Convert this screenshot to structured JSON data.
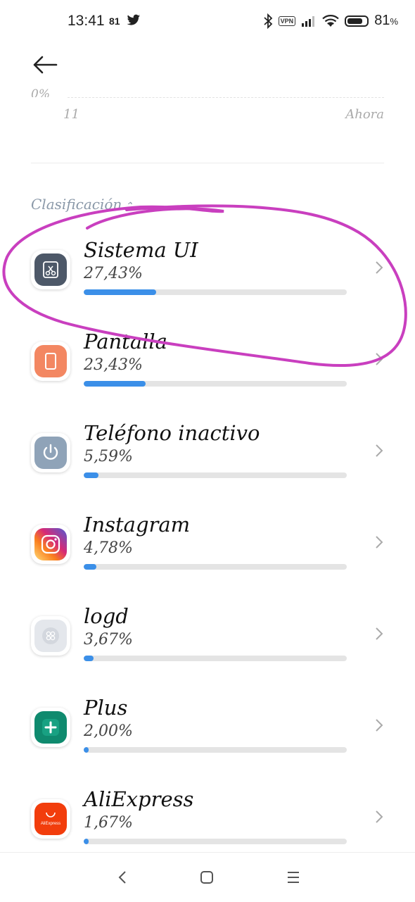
{
  "status_bar": {
    "time": "13:41",
    "notification_count": "81",
    "vpn_label": "VPN",
    "battery_value": "81",
    "battery_unit": "%",
    "battery_level": 0.81
  },
  "chart": {
    "y_min_label": "0%",
    "x_start_label": "11",
    "x_end_label": "Ahora"
  },
  "section": {
    "title": "Clasificación"
  },
  "items": [
    {
      "name": "Sistema UI",
      "percent": "27,43%",
      "fraction": 0.2743,
      "icon": "system-ui-icon",
      "color": "#4d5868"
    },
    {
      "name": "Pantalla",
      "percent": "23,43%",
      "fraction": 0.2343,
      "icon": "screen-icon",
      "color": "#f38762"
    },
    {
      "name": "Teléfono inactivo",
      "percent": "5,59%",
      "fraction": 0.0559,
      "icon": "power-icon",
      "color": "#8fa3b8"
    },
    {
      "name": "Instagram",
      "percent": "4,78%",
      "fraction": 0.0478,
      "icon": "instagram-icon",
      "color": "#d62976"
    },
    {
      "name": "logd",
      "percent": "3,67%",
      "fraction": 0.0367,
      "icon": "logd-icon",
      "color": "#e4e7ec"
    },
    {
      "name": "Plus",
      "percent": "2,00%",
      "fraction": 0.02,
      "icon": "plus-icon",
      "color": "#0f8a6e"
    },
    {
      "name": "AliExpress",
      "percent": "1,67%",
      "fraction": 0.0167,
      "icon": "aliexpress-icon",
      "color": "#f23d0c",
      "icon_text": "AliExpress"
    }
  ],
  "colors": {
    "accent": "#3b8fe8",
    "annotation": "#c93fbf",
    "track": "#e4e4e4"
  }
}
